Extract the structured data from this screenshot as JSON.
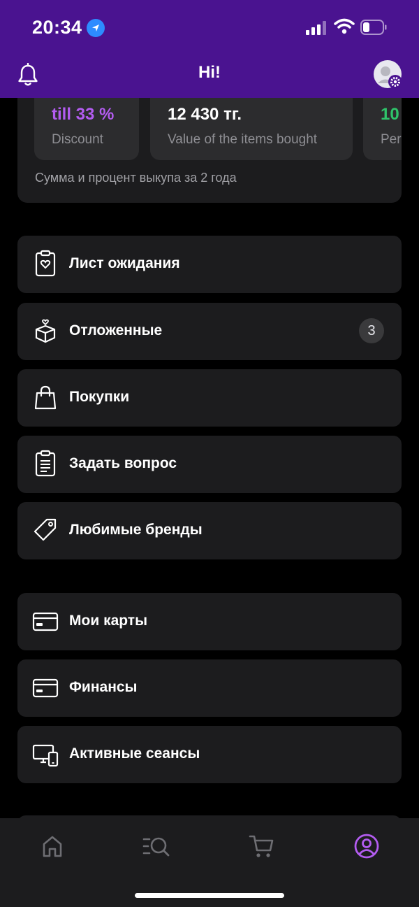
{
  "status_bar": {
    "time": "20:34"
  },
  "header": {
    "title": "Hi!"
  },
  "stats": {
    "cards": [
      {
        "value": "till 33 %",
        "label": "Discount",
        "value_color": "#b35cf0"
      },
      {
        "value": "12 430 тг.",
        "label": "Value of the items bought",
        "value_color": "#ffffff"
      },
      {
        "value": "10",
        "label": "Per",
        "value_color": "#2fc46a"
      }
    ],
    "note": "Сумма и процент выкупа за 2 года"
  },
  "menu": {
    "waitlist": {
      "label": "Лист ожидания",
      "icon": "clipboard-heart-icon"
    },
    "deferred": {
      "label": "Отложенные",
      "icon": "gift-box-icon",
      "badge": "3"
    },
    "purchases": {
      "label": "Покупки",
      "icon": "shopping-bag-icon"
    },
    "ask_question": {
      "label": "Задать вопрос",
      "icon": "clipboard-list-icon"
    },
    "favorite_brands": {
      "label": "Любимые бренды",
      "icon": "tag-icon"
    },
    "my_cards": {
      "label": "Мои карты",
      "icon": "credit-card-icon"
    },
    "finance": {
      "label": "Финансы",
      "icon": "credit-card-icon"
    },
    "sessions": {
      "label": "Активные сеансы",
      "icon": "devices-icon"
    }
  },
  "tabbar": {
    "tabs": [
      "home-icon",
      "catalog-search-icon",
      "cart-icon",
      "profile-icon"
    ],
    "active": "profile-icon",
    "active_color": "#b35cf0",
    "inactive_color": "#6e6e73"
  }
}
